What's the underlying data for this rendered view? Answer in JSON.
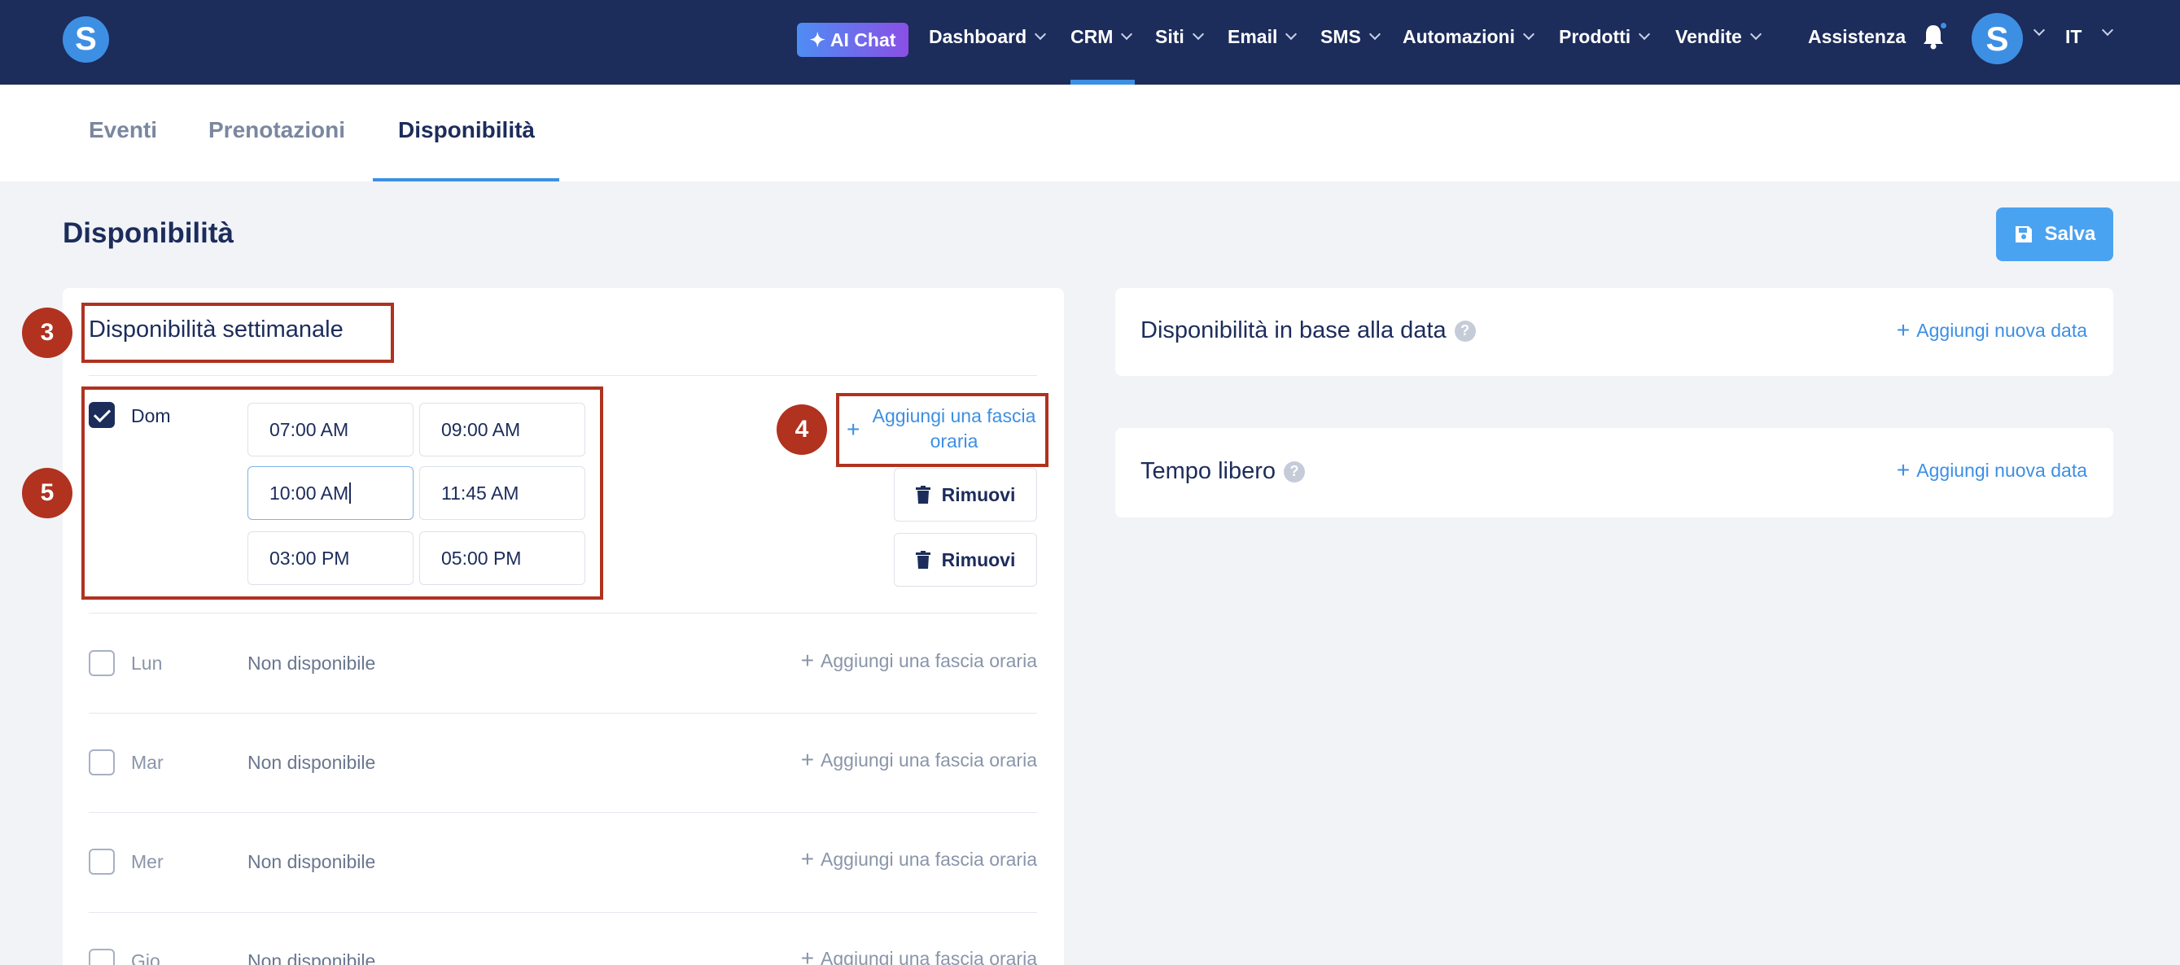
{
  "topbar": {
    "logo_letter": "S",
    "ai_chat_label": "AI Chat",
    "nav": [
      {
        "label": "Dashboard"
      },
      {
        "label": "CRM"
      },
      {
        "label": "Siti"
      },
      {
        "label": "Email"
      },
      {
        "label": "SMS"
      },
      {
        "label": "Automazioni"
      },
      {
        "label": "Prodotti"
      },
      {
        "label": "Vendite"
      }
    ],
    "active_nav": "CRM",
    "help_label": "Assistenza",
    "avatar_letter": "S",
    "language": "IT"
  },
  "subtabs": [
    {
      "label": "Eventi"
    },
    {
      "label": "Prenotazioni"
    },
    {
      "label": "Disponibilità"
    }
  ],
  "active_subtab": "Disponibilità",
  "page": {
    "title": "Disponibilità",
    "save_label": "Salva"
  },
  "weekly": {
    "title": "Disponibilità settimanale",
    "add_slot_label": "Aggiungi una fascia oraria",
    "remove_label": "Rimuovi",
    "unavailable_label": "Non disponibile",
    "days": [
      {
        "label": "Dom",
        "checked": true,
        "slots": [
          {
            "start": "07:00 AM",
            "end": "09:00 AM"
          },
          {
            "start": "10:00 AM",
            "end": "11:45 AM"
          },
          {
            "start": "03:00 PM",
            "end": "05:00 PM"
          }
        ]
      },
      {
        "label": "Lun",
        "checked": false
      },
      {
        "label": "Mar",
        "checked": false
      },
      {
        "label": "Mer",
        "checked": false
      },
      {
        "label": "Gio",
        "checked": false
      }
    ]
  },
  "date_based": {
    "title": "Disponibilità in base alla data",
    "add_label": "Aggiungi nuova data"
  },
  "free_time": {
    "title": "Tempo libero",
    "add_label": "Aggiungi nuova data"
  },
  "annotations": {
    "badge_3": "3",
    "badge_4": "4",
    "badge_5": "5",
    "color": "#b0321f"
  },
  "colors": {
    "navbar": "#1c2c5b",
    "accent": "#3d8fe3",
    "save_button": "#4aa3f0"
  }
}
